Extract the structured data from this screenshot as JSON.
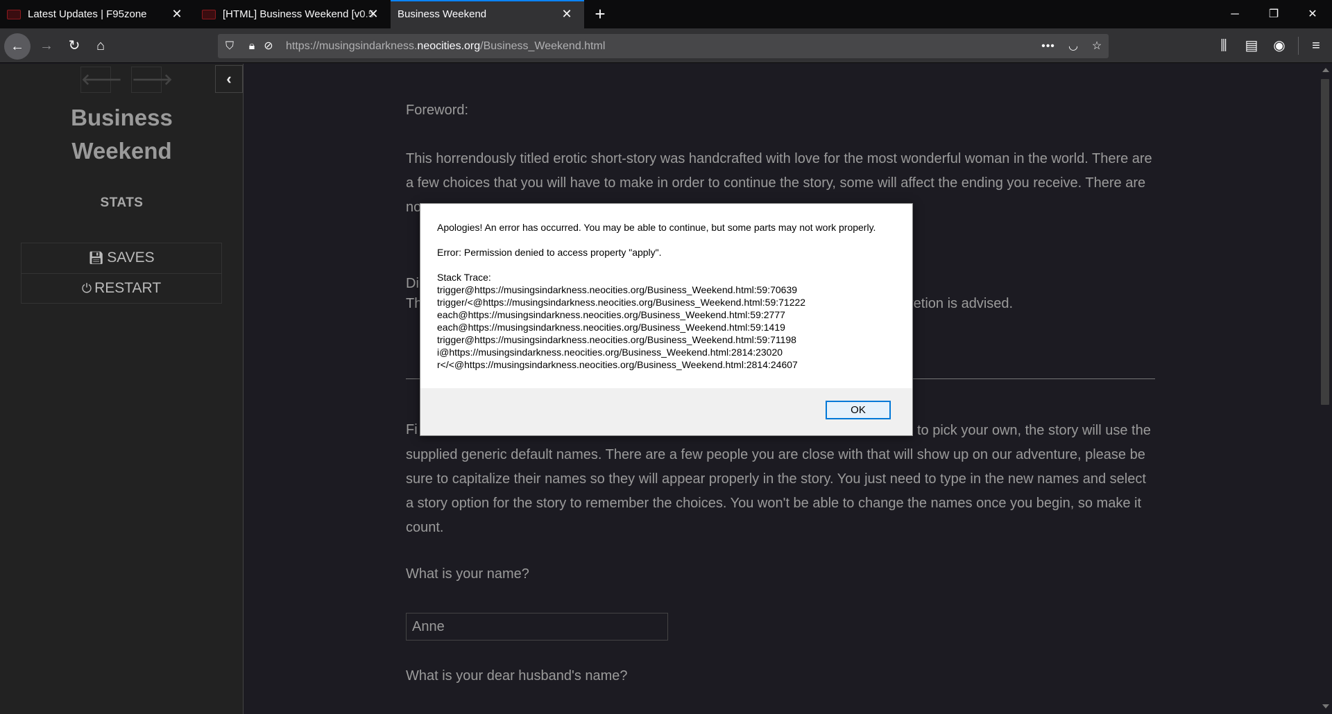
{
  "browser": {
    "tabs": [
      {
        "title": "Latest Updates | F95zone",
        "active": false
      },
      {
        "title": "[HTML] Business Weekend [v0.5",
        "active": false
      },
      {
        "title": "Business Weekend",
        "active": true
      }
    ],
    "url_prefix": "https://musingsindarkness.",
    "url_host": "neocities.org",
    "url_path": "/Business_Weekend.html",
    "accent_color": "#0a84ff"
  },
  "sidebar": {
    "title_line1": "Business",
    "title_line2": "Weekend",
    "stats_label": "STATS",
    "saves_label": "SAVES",
    "restart_label": "RESTART"
  },
  "passage": {
    "foreword_heading": "Foreword:",
    "foreword_text": "This horrendously titled erotic short-story was handcrafted with love for the most wonderful woman in the world. There are a few choices that you will have to make in order to continue the story, some will affect the ending you receive. There are no",
    "disclaimer_fragment": "Di",
    "disclaimer_text_start": "Th",
    "disclaimer_text_end": "retion is advised.",
    "names_intro_start": "Fi",
    "names_intro_rest": "to pick your own, the story will use the supplied generic default names. There are a few people you are close with that will show up on our adventure, please be sure to capitalize their names so they will appear properly in the story. You just need to type in the new names and select a story option for the story to remember the choices. You won't be able to change the names once you begin, so make it count.",
    "q_name": "What is your name?",
    "name_value": "Anne",
    "q_husband": "What is your dear husband's name?"
  },
  "dialog": {
    "message": "Apologies! An error has occurred. You may be able to continue, but some parts may not work properly.",
    "error": "Error: Permission denied to access property \"apply\".",
    "stack_heading": "Stack Trace:",
    "stack": [
      "trigger@https://musingsindarkness.neocities.org/Business_Weekend.html:59:70639",
      "trigger/<@https://musingsindarkness.neocities.org/Business_Weekend.html:59:71222",
      "each@https://musingsindarkness.neocities.org/Business_Weekend.html:59:2777",
      "each@https://musingsindarkness.neocities.org/Business_Weekend.html:59:1419",
      "trigger@https://musingsindarkness.neocities.org/Business_Weekend.html:59:71198",
      "i@https://musingsindarkness.neocities.org/Business_Weekend.html:2814:23020",
      "r</<@https://musingsindarkness.neocities.org/Business_Weekend.html:2814:24607"
    ],
    "ok_label": "OK"
  }
}
